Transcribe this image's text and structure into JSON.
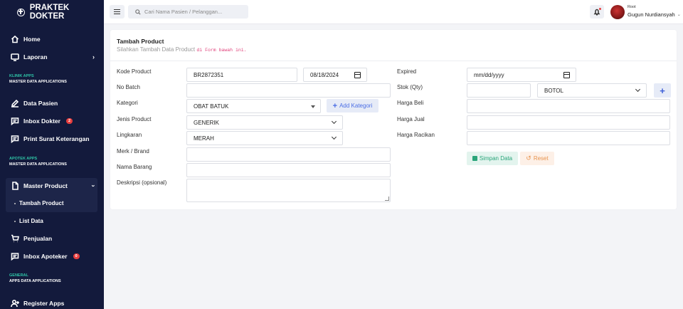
{
  "app": {
    "brand": "PRAKTEK DOKTER"
  },
  "sidebar": {
    "home": "Home",
    "laporan": "Laporan",
    "klinik_section": {
      "title": "KLINIK APPS",
      "subtitle": "MASTER DATA APPLICATIONS"
    },
    "data_pasien": "Data Pasien",
    "inbox_dokter": "Inbox Dokter",
    "inbox_dokter_count": "2",
    "print_surat": "Print Surat Keterangan",
    "apotek_section": {
      "title": "APOTEK APPS",
      "subtitle": "MASTER DATA APPLICATIONS"
    },
    "master_product": "Master Product",
    "tambah_product": "Tambah Product",
    "list_data": "List Data",
    "penjualan": "Penjualan",
    "inbox_apoteker": "Inbox Apoteker",
    "inbox_apoteker_count": "0",
    "general_section": {
      "title": "GENERAL",
      "subtitle": "APPS DATA APPLICATIONS"
    },
    "register_apps": "Register Apps"
  },
  "topbar": {
    "search_placeholder": "Cari Nama Pasien / Pelanggan...",
    "user_role": "Root",
    "user_name": "Gugun Nurdiansyah"
  },
  "card": {
    "title": "Tambah Product",
    "subtitle": "Silahkan Tambah Data Product",
    "subtitle_code": "di Form bawah ini."
  },
  "form": {
    "kode_product": {
      "label": "Kode Product",
      "value": "BR2872351"
    },
    "tanggal": {
      "value": "08/18/2024"
    },
    "no_batch": {
      "label": "No Batch",
      "value": ""
    },
    "kategori": {
      "label": "Kategori",
      "value": "OBAT BATUK"
    },
    "add_kategori_label": "Add Kategori",
    "jenis_product": {
      "label": "Jenis Product",
      "value": "GENERIK"
    },
    "lingkaran": {
      "label": "Lingkaran",
      "value": "MERAH"
    },
    "merk_brand": {
      "label": "Merk / Brand",
      "value": ""
    },
    "nama_barang": {
      "label": "Nama Barang",
      "value": ""
    },
    "deskripsi": {
      "label": "Deskripsi (opsional)",
      "value": ""
    },
    "expired": {
      "label": "Expired",
      "value": "mm/dd/yyyy"
    },
    "stok": {
      "label": "Stok (Qty)",
      "value": ""
    },
    "satuan": {
      "value": "BOTOL"
    },
    "harga_beli": {
      "label": "Harga Beli",
      "value": ""
    },
    "harga_jual": {
      "label": "Harga Jual",
      "value": ""
    },
    "harga_racikan": {
      "label": "Harga Racikan",
      "value": ""
    },
    "simpan_label": "Simpan Data",
    "reset_label": "Reset"
  }
}
